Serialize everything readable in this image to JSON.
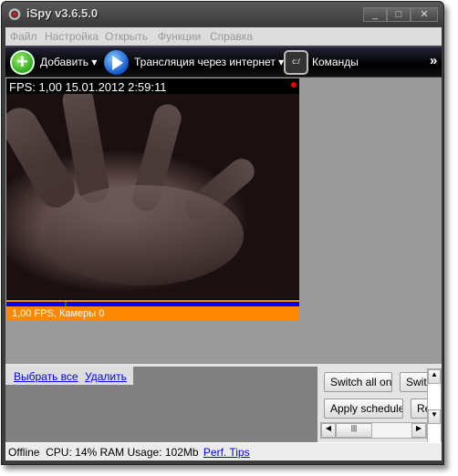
{
  "window": {
    "title": "iSpy v3.6.5.0",
    "minimize": "_",
    "maximize": "□",
    "close": "✕"
  },
  "menu": [
    "Файл",
    "Настройка",
    "Открыть",
    "Функции",
    "Справка"
  ],
  "toolbar": {
    "add": "Добавить ▾",
    "broadcast": "Трансляция через интернет ▾",
    "commands": "Команды",
    "commands_icon_text": "c:/",
    "more": "»"
  },
  "camera": {
    "overlay": "FPS: 1,00 15.01.2012 2:59:11",
    "status": "1,00 FPS, Камеры 0",
    "recording_indicator_color": "#ee0000"
  },
  "lower": {
    "select_all": "Выбрать все",
    "delete": "Удалить",
    "buttons": [
      "Switch all on",
      "Switc",
      "Apply schedule",
      "Re"
    ]
  },
  "statusbar": {
    "state": "Offline",
    "usage": "CPU: 14% RAM Usage: 102Mb",
    "perf_tips": "Perf. Tips"
  }
}
